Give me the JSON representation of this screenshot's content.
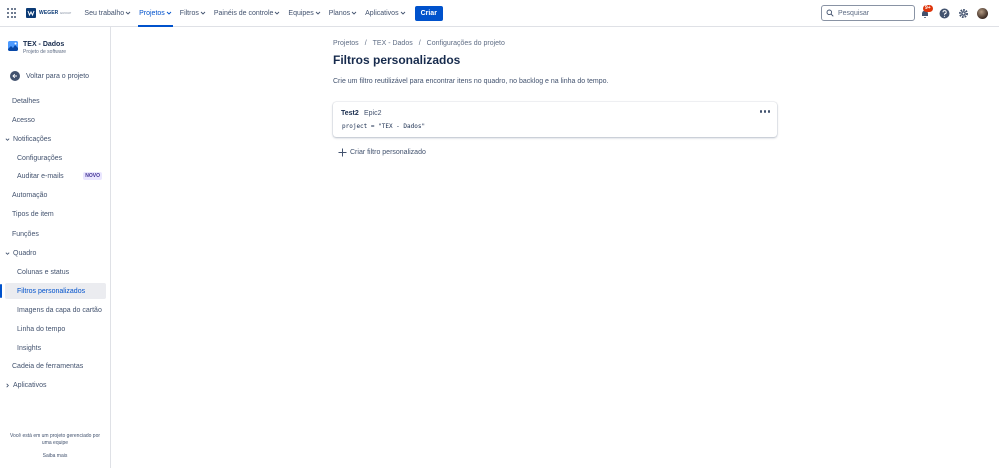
{
  "topbar": {
    "logo_text": "WEGER",
    "logo_sub": "GROUP",
    "nav": [
      {
        "label": "Seu trabalho",
        "active": false
      },
      {
        "label": "Projetos",
        "active": true
      },
      {
        "label": "Filtros",
        "active": false
      },
      {
        "label": "Painéis de controle",
        "active": false
      },
      {
        "label": "Equipes",
        "active": false
      },
      {
        "label": "Planos",
        "active": false
      },
      {
        "label": "Aplicativos",
        "active": false
      }
    ],
    "create_label": "Criar",
    "search_placeholder": "Pesquisar",
    "notifications_badge": "9+"
  },
  "sidebar": {
    "project_name": "TEX - Dados",
    "project_type": "Projeto de software",
    "back_label": "Voltar para o projeto",
    "items": [
      {
        "label": "Detalhes"
      },
      {
        "label": "Acesso"
      },
      {
        "label": "Notificações"
      },
      {
        "label": "Configurações"
      },
      {
        "label": "Auditar e-mails",
        "badge": "NOVO"
      },
      {
        "label": "Automação"
      },
      {
        "label": "Tipos de item"
      },
      {
        "label": "Funções"
      },
      {
        "label": "Quadro"
      },
      {
        "label": "Colunas e status"
      },
      {
        "label": "Filtros personalizados",
        "selected": true
      },
      {
        "label": "Imagens da capa do cartão"
      },
      {
        "label": "Linha do tempo"
      },
      {
        "label": "Insights"
      },
      {
        "label": "Cadeia de ferramentas"
      },
      {
        "label": "Aplicativos"
      }
    ],
    "footer_text_1": "Você está em um projeto gerenciado por",
    "footer_text_2": "uma equipe",
    "footer_link": "Saiba mais"
  },
  "main": {
    "breadcrumbs": [
      "Projetos",
      "TEX - Dados",
      "Configurações do projeto"
    ],
    "breadcrumb_sep": "/",
    "title": "Filtros personalizados",
    "description": "Crie um filtro reutilizável para encontrar itens no quadro, no backlog e na linha do tempo.",
    "filters": [
      {
        "name": "Test2",
        "tag": "Epic2",
        "query": "project = \"TEX - Dados\""
      }
    ],
    "create_filter_label": "Criar filtro personalizado"
  },
  "colors": {
    "accent": "#0052cc",
    "text": "#172b4d",
    "subtle": "#42526e",
    "badge": "#de350b"
  }
}
